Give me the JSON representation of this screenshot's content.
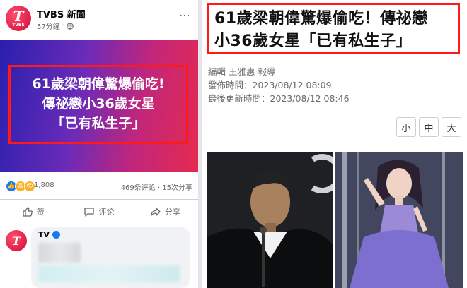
{
  "facebook_post": {
    "page_name": "TVBS 新聞",
    "post_time": "57分鐘",
    "avatar_text": "T",
    "avatar_subtext": "TVBS",
    "banner_lines": [
      "61歲梁朝偉驚爆偷吃!",
      "傳祕戀小36歲女星",
      "「已有私生子」"
    ],
    "reaction_count": "1,808",
    "comment_count": "469条评论",
    "share_count": "15次分享",
    "actions": {
      "like": "赞",
      "comment": "评论",
      "share": "分享"
    },
    "comment_name": "TV"
  },
  "article": {
    "headline_lines": [
      "61歲梁朝偉驚爆偷吃！傳祕戀",
      "小36歲女星「已有私生子」"
    ],
    "editor": "編輯 王雅惠 報導",
    "published": "發佈時間：2023/08/12 08:09",
    "updated": "最後更新時間：2023/08/12 08:46",
    "font_sizes": [
      "小",
      "中",
      "大"
    ]
  },
  "colors": {
    "highlight_border": "#ff1a1a",
    "fb_blue": "#1877f2",
    "tvbs_red": "#d10a3a"
  }
}
